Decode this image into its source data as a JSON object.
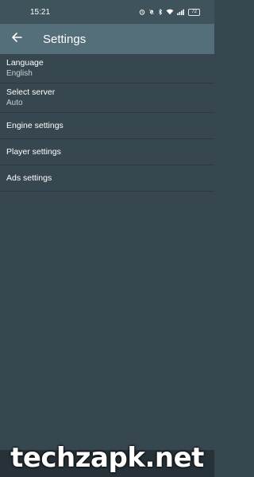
{
  "status_bar": {
    "time": "15:21",
    "battery": "72",
    "icons": [
      "alarm-icon",
      "notifications-off-icon",
      "bluetooth-icon",
      "wifi-icon",
      "signal-icon",
      "battery-icon"
    ]
  },
  "app_bar": {
    "title": "Settings",
    "back_icon": "arrow-back-icon"
  },
  "settings": {
    "items": [
      {
        "label": "Language",
        "value": "English"
      },
      {
        "label": "Select server",
        "value": "Auto"
      },
      {
        "label": "Engine settings"
      },
      {
        "label": "Player settings"
      },
      {
        "label": "Ads settings"
      }
    ]
  },
  "watermark": {
    "text": "techzapk.net"
  },
  "colors": {
    "background": "#37474f",
    "app_bar": "#546e7a",
    "status_bar": "#3f535c",
    "divider": "#2d3b41"
  }
}
